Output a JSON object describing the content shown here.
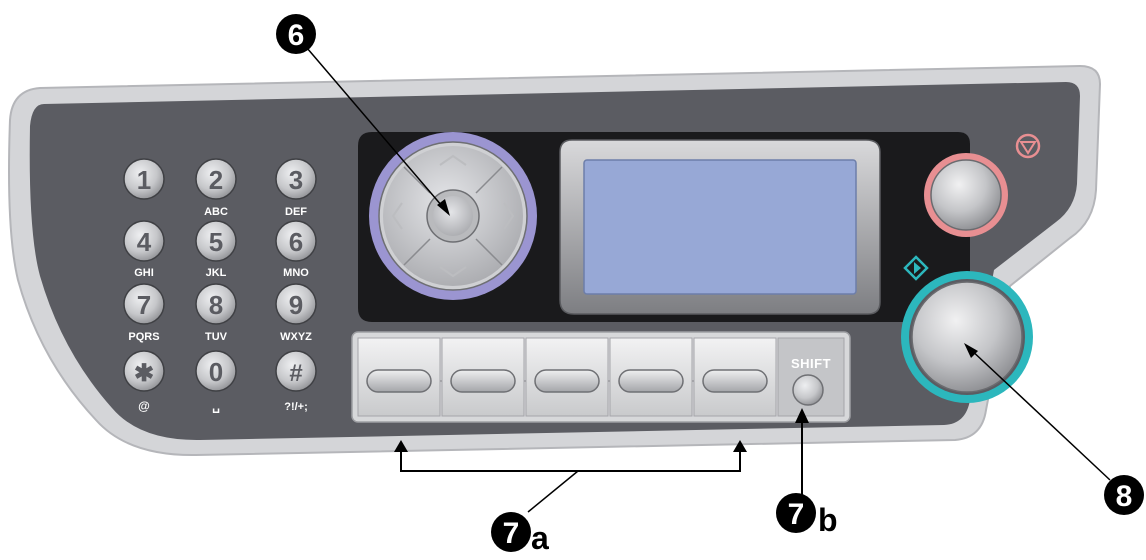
{
  "keypad": {
    "keys": [
      {
        "digit": "1",
        "sub": ""
      },
      {
        "digit": "2",
        "sub": "ABC"
      },
      {
        "digit": "3",
        "sub": "DEF"
      },
      {
        "digit": "4",
        "sub": "GHI"
      },
      {
        "digit": "5",
        "sub": "JKL"
      },
      {
        "digit": "6",
        "sub": "MNO"
      },
      {
        "digit": "7",
        "sub": "PQRS"
      },
      {
        "digit": "8",
        "sub": "TUV"
      },
      {
        "digit": "9",
        "sub": "WXYZ"
      },
      {
        "digit": "✱",
        "sub": "@"
      },
      {
        "digit": "0",
        "sub": "␣"
      },
      {
        "digit": "#",
        "sub": "?!/+;"
      }
    ]
  },
  "shift": {
    "label": "Shift"
  },
  "stop": {
    "icon": "stop-icon"
  },
  "start": {
    "icon": "start-icon"
  },
  "callouts": {
    "nav": {
      "number": "6",
      "suffix": ""
    },
    "softkeys": {
      "number": "7",
      "suffix": "a"
    },
    "shift": {
      "number": "7",
      "suffix": "b"
    },
    "start": {
      "number": "8",
      "suffix": ""
    }
  },
  "colors": {
    "panel": "#5b5c62",
    "panel_rim": "#d4d5d8",
    "display_bezel": "#1a1a1c",
    "lcd": "#97a8d6",
    "nav_ring": "#9b95d1",
    "stop_ring": "#e88f92",
    "start_ring": "#2cb7bd",
    "key": "#c9cacd",
    "callout": "#000000"
  }
}
